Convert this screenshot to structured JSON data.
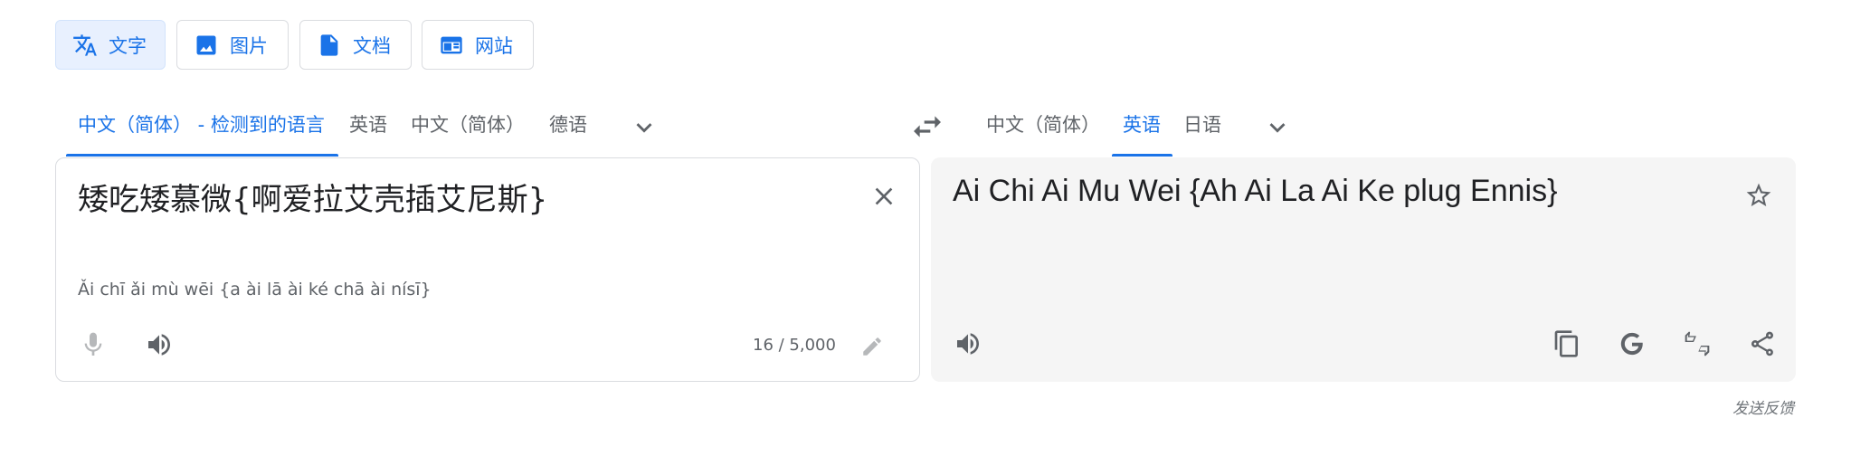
{
  "modes": [
    {
      "label": "文字",
      "icon": "translate-icon",
      "active": true
    },
    {
      "label": "图片",
      "icon": "image-icon",
      "active": false
    },
    {
      "label": "文档",
      "icon": "document-icon",
      "active": false
    },
    {
      "label": "网站",
      "icon": "website-icon",
      "active": false
    }
  ],
  "source_langs": {
    "detected": "中文（简体） - 检测到的语言",
    "items": [
      "英语",
      "中文（简体）",
      "德语"
    ]
  },
  "target_langs": {
    "items": [
      "中文（简体）",
      "英语",
      "日语"
    ],
    "active_index": 1
  },
  "source": {
    "text": "矮吃矮慕微{啊爱拉艾壳插艾尼斯}",
    "transliteration": "Ǎi chī ǎi mù wēi {a ài lā ài ké chā ài nísī}",
    "char_count": "16 / 5,000"
  },
  "target": {
    "text": "Ai Chi Ai Mu Wei {Ah Ai La Ai Ke plug Ennis}"
  },
  "feedback_label": "发送反馈",
  "colors": {
    "accent": "#1a73e8",
    "icon_grey": "#5f6368",
    "target_bg": "#f5f5f5"
  }
}
